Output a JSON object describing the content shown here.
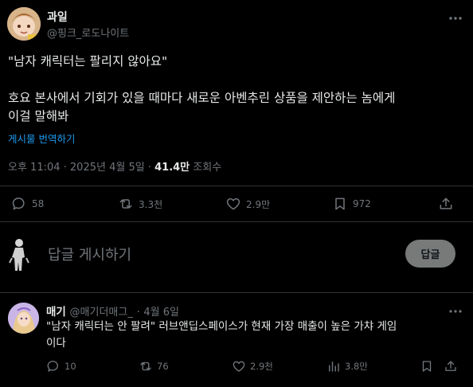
{
  "post": {
    "display_name": "과일",
    "handle": "@핑크_로도나이트",
    "text_line1": "\"남자 캐릭터는 팔리지 않아요\"",
    "text_line2": "호요 본사에서 기회가 있을 때마다 새로운 아벤추린 상품을 제안하는 놈에게",
    "text_line3": "이걸 말해봐",
    "translate_label": "게시물 번역하기",
    "timestamp": "오후 11:04 · 2025년 4월 5일",
    "separator": "·",
    "views_count": "41.4만",
    "views_label": "조회수",
    "actions": {
      "replies": "58",
      "reposts": "3.3천",
      "likes": "2.9만",
      "bookmarks": "972"
    }
  },
  "reply_box": {
    "placeholder": "답글 게시하기",
    "button_label": "답글"
  },
  "reply": {
    "display_name": "매기",
    "handle": "@매기더매그_",
    "separator": "·",
    "date": "4월 6일",
    "text_line1": "\"남자 캐릭터는 안 팔려\" 러브앤딥스페이스가 현재 가장 매출이 높은 가챠 게임",
    "text_line2": "이다",
    "actions": {
      "replies": "10",
      "reposts": "76",
      "likes": "2.9천",
      "views": "3.8만"
    }
  },
  "colors": {
    "background": "#000000",
    "text": "#e7e9ea",
    "muted": "#71767b",
    "link": "#1d9bf0",
    "divider": "#2f3336",
    "reply_button": "#787a7a"
  }
}
